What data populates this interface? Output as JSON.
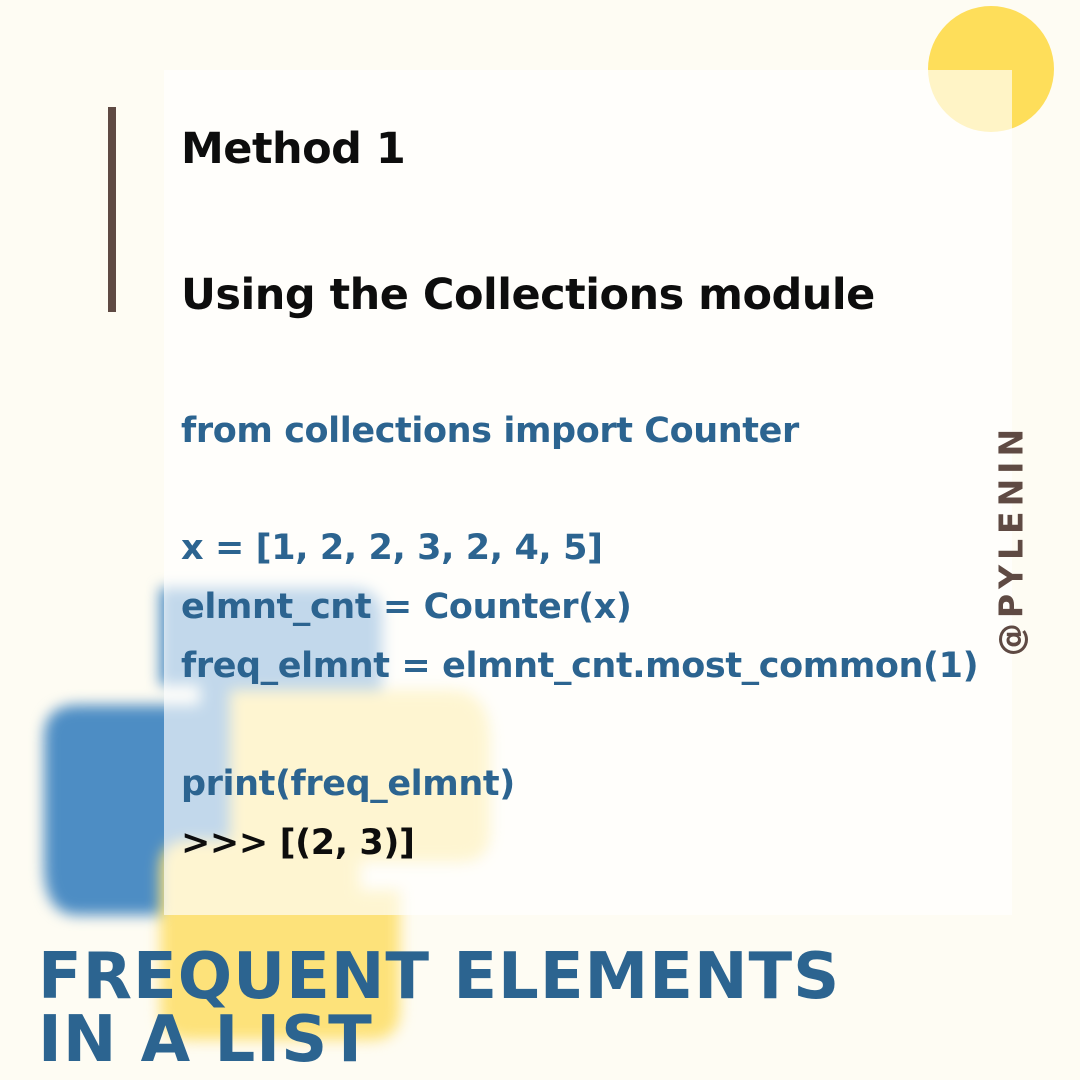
{
  "heading": {
    "method": "Method 1",
    "subtitle": "Using the Collections module"
  },
  "code": {
    "import_line": "from collections import Counter",
    "list_line": "x = [1, 2, 2, 3, 2, 4, 5]",
    "counter_line": "elmnt_cnt = Counter(x)",
    "most_common_line": "freq_elmnt = elmnt_cnt.most_common(1)",
    "print_line": "print(freq_elmnt)",
    "output_line": ">>> [(2, 3)]"
  },
  "handle": "@PYLENIN",
  "title": {
    "line1": "FREQUENT ELEMENTS",
    "line2": "IN A LIST"
  },
  "icons": {
    "logo": "python-logo-icon",
    "circle": "yellow-circle-decoration"
  },
  "colors": {
    "background": "#fefcf3",
    "code_blue": "#2c6490",
    "accent_brown": "#5f4a43",
    "yellow": "#fede5a"
  }
}
